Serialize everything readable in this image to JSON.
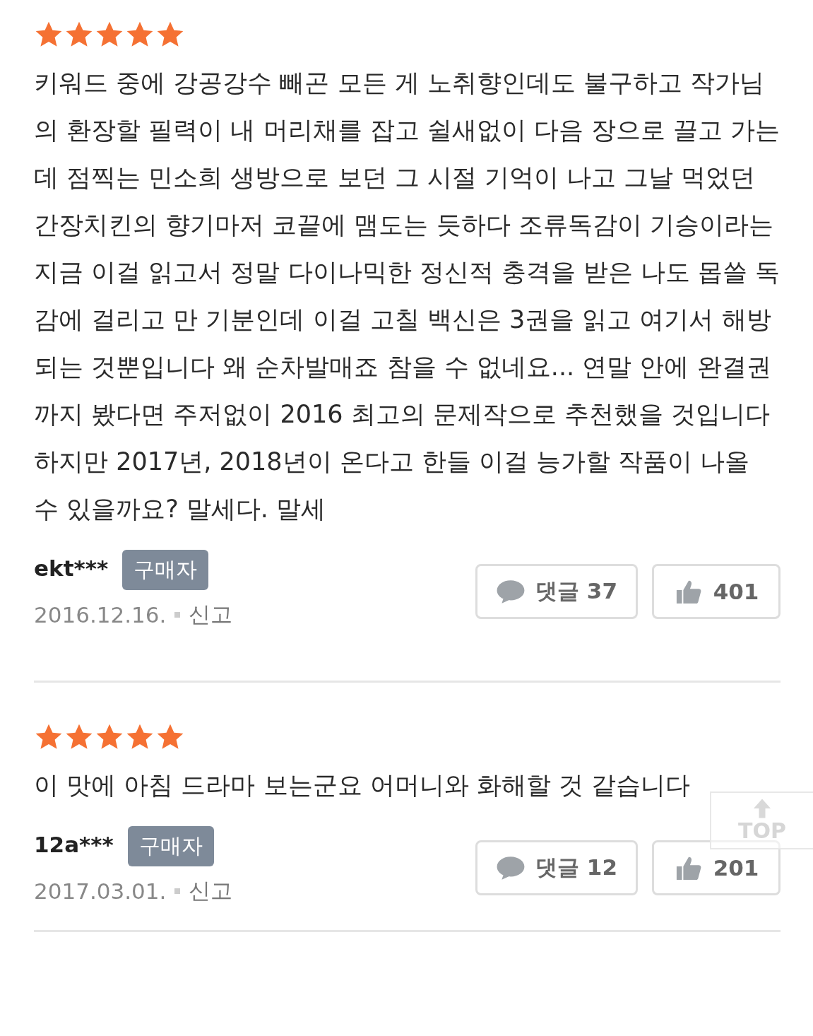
{
  "reviews": [
    {
      "stars": 5,
      "text": "키워드 중에 강공강수 빼곤 모든 게 노취향인데도 불구하고 작가님의 환장할 필력이 내 머리채를 잡고 쉴새없이 다음 장으로 끌고 가는데 점찍는 민소희 생방으로 보던 그 시절 기억이 나고 그날 먹었던 간장치킨의 향기마저 코끝에 맴도는 듯하다 조류독감이 기승이라는 지금 이걸 읽고서 정말 다이나믹한 정신적 충격을 받은 나도 몹쓸 독감에 걸리고 만 기분인데 이걸 고칠 백신은 3권을 읽고 여기서 해방되는 것뿐입니다 왜 순차발매죠 참을 수 없네요... 연말 안에 완결권까지 봤다면 주저없이 2016 최고의 문제작으로 추천했을 것입니다 하지만 2017년, 2018년이 온다고 한들 이걸 능가할 작품이 나올 수 있을까요? 말세다. 말세",
      "user": "ekt***",
      "badge": "구매자",
      "date": "2016.12.16.",
      "report": "신고",
      "comments": "댓글 37",
      "likes": "401"
    },
    {
      "stars": 5,
      "text": "이 맛에 아침 드라마 보는군요 어머니와 화해할 것 같습니다",
      "user": "12a***",
      "badge": "구매자",
      "date": "2017.03.01.",
      "report": "신고",
      "comments": "댓글 12",
      "likes": "201"
    }
  ],
  "top_button": {
    "label": "TOP"
  }
}
